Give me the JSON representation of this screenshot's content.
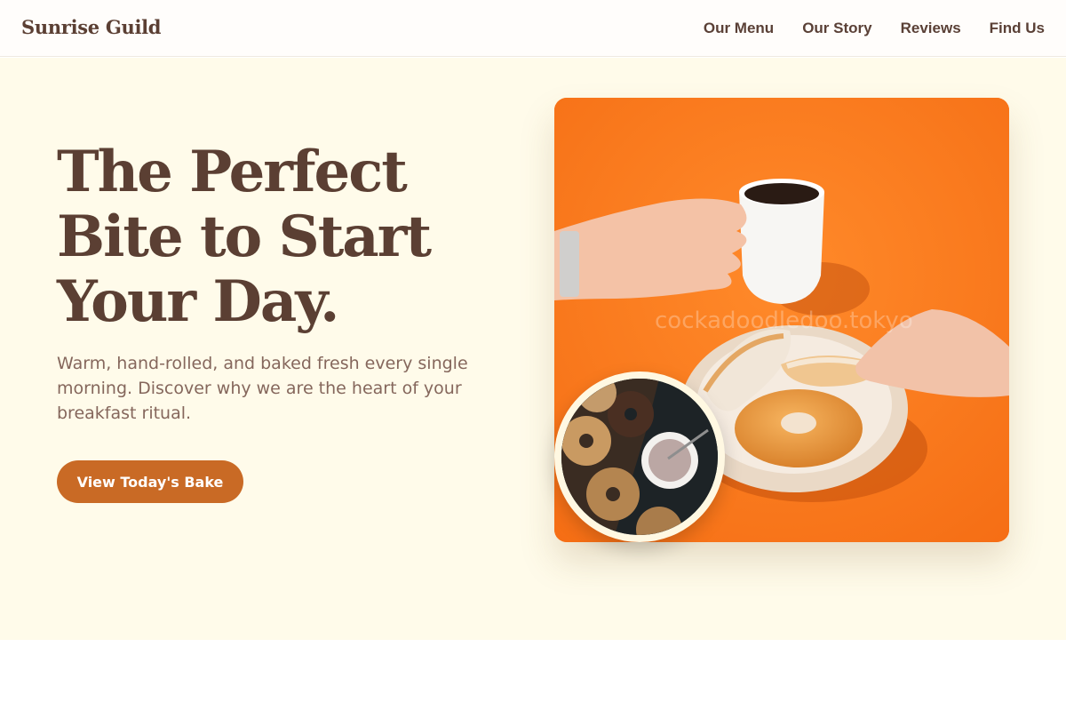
{
  "nav": {
    "brand": "Sunrise Guild",
    "links": [
      {
        "label": "Our Menu"
      },
      {
        "label": "Our Story"
      },
      {
        "label": "Reviews"
      },
      {
        "label": "Find Us"
      }
    ]
  },
  "hero": {
    "headline_lines": [
      "The Perfect",
      "Bite to Start",
      "Your Day."
    ],
    "subtitle": "Warm, hand-rolled, and baked fresh every single morning. Discover why we are the heart of your breakfast ritual.",
    "cta_label": "View Today's Bake",
    "main_image_alt": "Hands holding coffee cup and bagels on orange background",
    "main_image_watermark": "cockadoodledoo.tokyo",
    "inset_image_alt": "Assorted bagels with cream cheese"
  },
  "colors": {
    "brand_text": "#5b3f33",
    "hero_bg": "#fffbea",
    "accent": "#c96a25",
    "photo_bg": "#ff7a1f"
  }
}
